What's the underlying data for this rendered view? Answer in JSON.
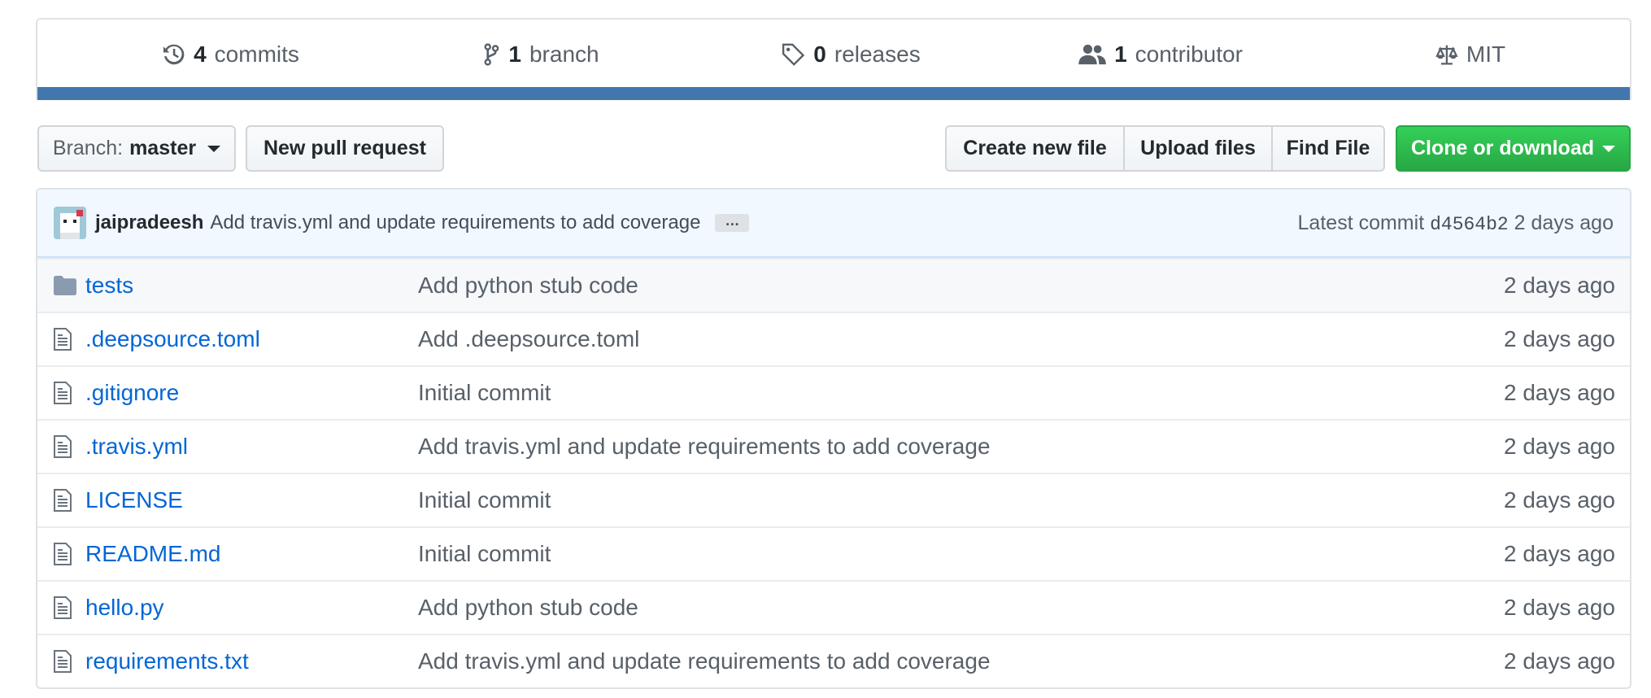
{
  "summary": {
    "commits": {
      "count": "4",
      "label": "commits",
      "icon": "history-icon"
    },
    "branches": {
      "count": "1",
      "label": "branch",
      "icon": "git-branch-icon"
    },
    "releases": {
      "count": "0",
      "label": "releases",
      "icon": "tag-icon"
    },
    "contributors": {
      "count": "1",
      "label": "contributor",
      "icon": "people-icon"
    },
    "license": {
      "label": "MIT",
      "icon": "law-icon"
    },
    "language_bar_color": "#4277ad"
  },
  "toolbar": {
    "branch_prefix": "Branch:",
    "branch_name": "master",
    "new_pull_request": "New pull request",
    "create_new_file": "Create new file",
    "upload_files": "Upload files",
    "find_file": "Find File",
    "clone_or_download": "Clone or download"
  },
  "latest_commit": {
    "author": "jaipradeesh",
    "message": "Add travis.yml and update requirements to add coverage",
    "ellipsis": "…",
    "prefix": "Latest commit",
    "sha": "d4564b2",
    "age": "2 days ago"
  },
  "files": [
    {
      "name": "tests",
      "type": "directory",
      "icon": "folder-icon",
      "message": "Add python stub code",
      "age": "2 days ago"
    },
    {
      "name": ".deepsource.toml",
      "type": "file",
      "icon": "file-icon",
      "message": "Add .deepsource.toml",
      "age": "2 days ago"
    },
    {
      "name": ".gitignore",
      "type": "file",
      "icon": "file-icon",
      "message": "Initial commit",
      "age": "2 days ago"
    },
    {
      "name": ".travis.yml",
      "type": "file",
      "icon": "file-icon",
      "message": "Add travis.yml and update requirements to add coverage",
      "age": "2 days ago"
    },
    {
      "name": "LICENSE",
      "type": "file",
      "icon": "file-icon",
      "message": "Initial commit",
      "age": "2 days ago"
    },
    {
      "name": "README.md",
      "type": "file",
      "icon": "file-icon",
      "message": "Initial commit",
      "age": "2 days ago"
    },
    {
      "name": "hello.py",
      "type": "file",
      "icon": "file-icon",
      "message": "Add python stub code",
      "age": "2 days ago"
    },
    {
      "name": "requirements.txt",
      "type": "file",
      "icon": "file-icon",
      "message": "Add travis.yml and update requirements to add coverage",
      "age": "2 days ago"
    }
  ],
  "colors": {
    "link": "#0366d6",
    "muted": "#586069",
    "clone_button": "#28a745",
    "commit_tease_bg": "#f1f8ff",
    "icon": "#6a737d"
  }
}
